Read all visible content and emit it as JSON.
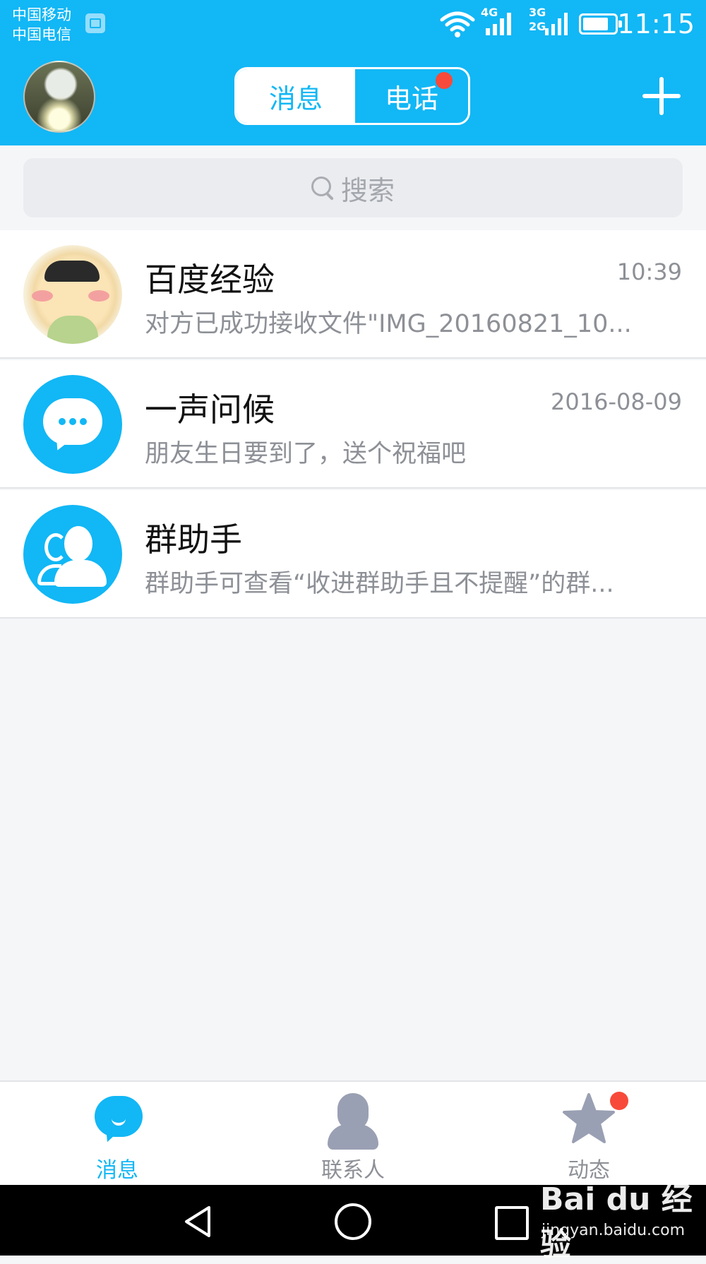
{
  "status_bar": {
    "carrier_1": "中国移动",
    "carrier_2": "中国电信",
    "network_1": "4G",
    "network_2a": "3G",
    "network_2b": "2G",
    "time": "11:15"
  },
  "header": {
    "tabs": [
      {
        "label": "消息",
        "selected": true
      },
      {
        "label": "电话",
        "selected": false,
        "has_badge": true
      }
    ]
  },
  "search": {
    "placeholder": "搜索"
  },
  "conversations": [
    {
      "title": "百度经验",
      "time": "10:39",
      "preview": "对方已成功接收文件\"IMG_20160821_10...",
      "avatar": "cartoon-avatar"
    },
    {
      "title": "一声问候",
      "time": "2016-08-09",
      "preview": "朋友生日要到了，送个祝福吧",
      "avatar": "chat-bubble-icon"
    },
    {
      "title": "群助手",
      "time": "",
      "preview": "群助手可查看“收进群助手且不提醒”的群...",
      "avatar": "group-icon"
    }
  ],
  "bottom_nav": [
    {
      "label": "消息",
      "icon": "chat-icon",
      "active": true
    },
    {
      "label": "联系人",
      "icon": "contacts-icon",
      "active": false
    },
    {
      "label": "动态",
      "icon": "star-icon",
      "active": false,
      "has_badge": true
    }
  ],
  "watermark": {
    "logo": "Bai du 经验",
    "url": "jingyan.baidu.com"
  },
  "colors": {
    "accent": "#12b7f5",
    "badge": "#f84a3a",
    "inactive_nav": "#9aa0b3",
    "muted_text": "#8d9096"
  }
}
